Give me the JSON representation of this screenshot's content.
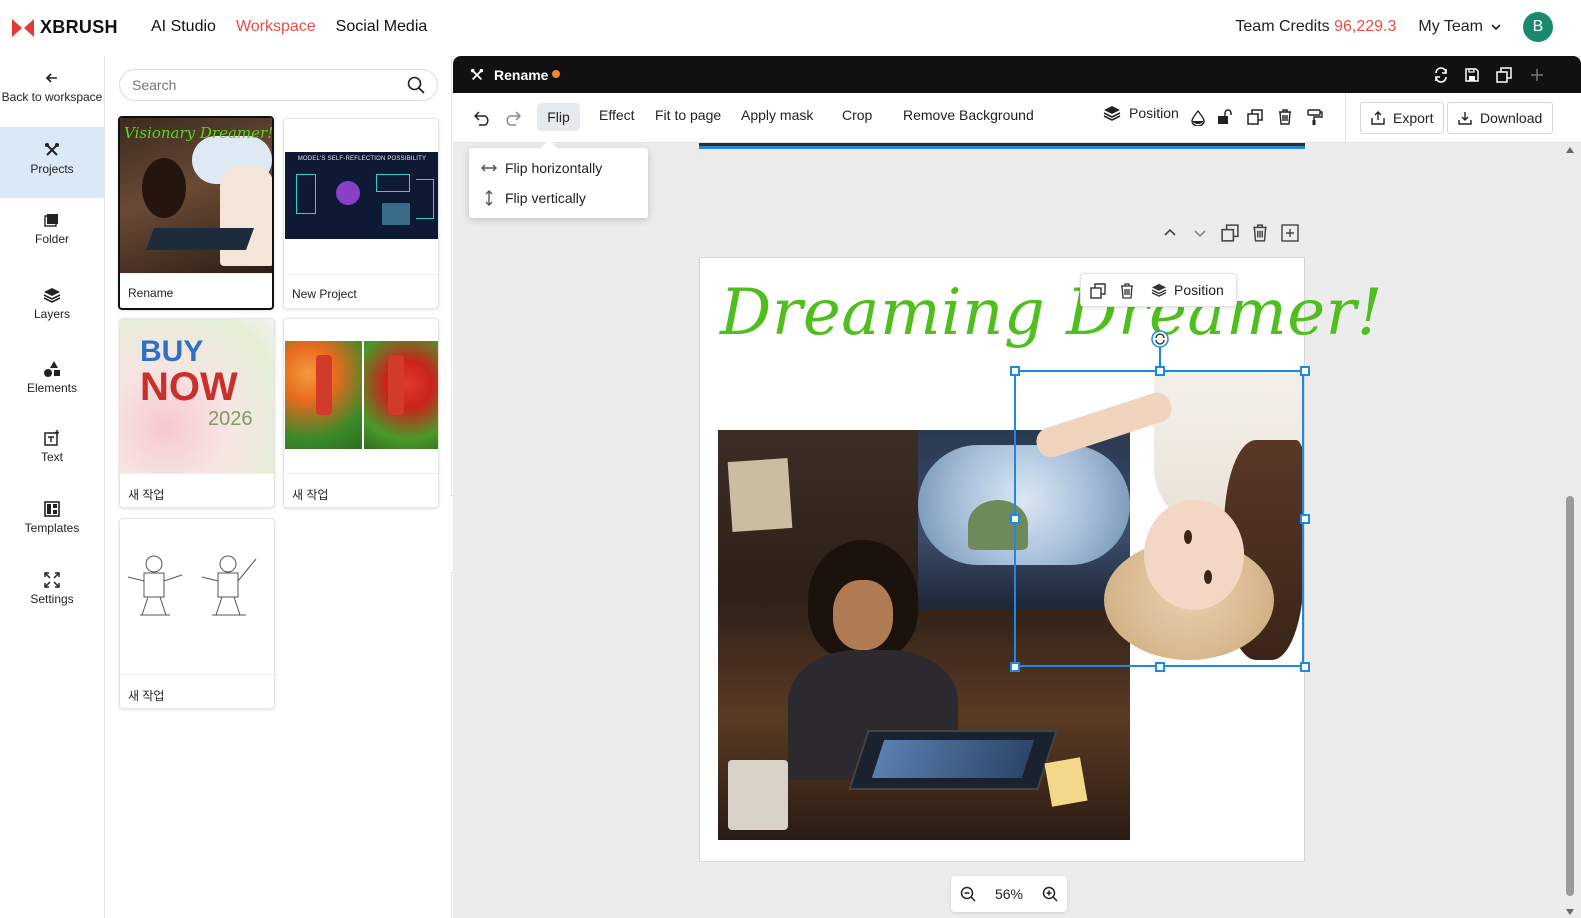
{
  "brand": {
    "name": "XBRUSH"
  },
  "nav": {
    "links": [
      "AI Studio",
      "Workspace",
      "Social Media"
    ],
    "active": "Workspace"
  },
  "header": {
    "credits_label": "Team Credits",
    "credits_value": "96,229.3",
    "team": "My Team",
    "avatar_initial": "B"
  },
  "sidebar": {
    "back": "Back to workspace",
    "items": [
      "Projects",
      "Folder",
      "Layers",
      "Elements",
      "Text",
      "Templates",
      "Settings"
    ]
  },
  "projects": {
    "search_placeholder": "Search",
    "cards": [
      {
        "label": "Rename",
        "thumb_text": "Visionary Dreamer!"
      },
      {
        "label": "New Project",
        "thumb_text": "MODEL'S SELF-REFLECTION POSSIBILITY"
      },
      {
        "label": "새 작업",
        "thumb_text": "BUY NOW 2026"
      },
      {
        "label": "새 작업"
      },
      {
        "label": "새 작업"
      }
    ]
  },
  "editor": {
    "doc_name": "Rename",
    "toolbar": {
      "flip": "Flip",
      "effect": "Effect",
      "fit": "Fit to page",
      "mask": "Apply mask",
      "crop": "Crop",
      "remove_bg": "Remove Background",
      "position": "Position",
      "export": "Export",
      "download": "Download"
    },
    "flip_menu": {
      "horizontal": "Flip horizontally",
      "vertical": "Flip vertically"
    },
    "canvas": {
      "headline": "Dreaming Dreamer!"
    },
    "float_position": "Position",
    "zoom": "56%"
  },
  "colors": {
    "accent": "#e94d45",
    "selection": "#1e88e5",
    "headline": "#4fbf1d"
  }
}
